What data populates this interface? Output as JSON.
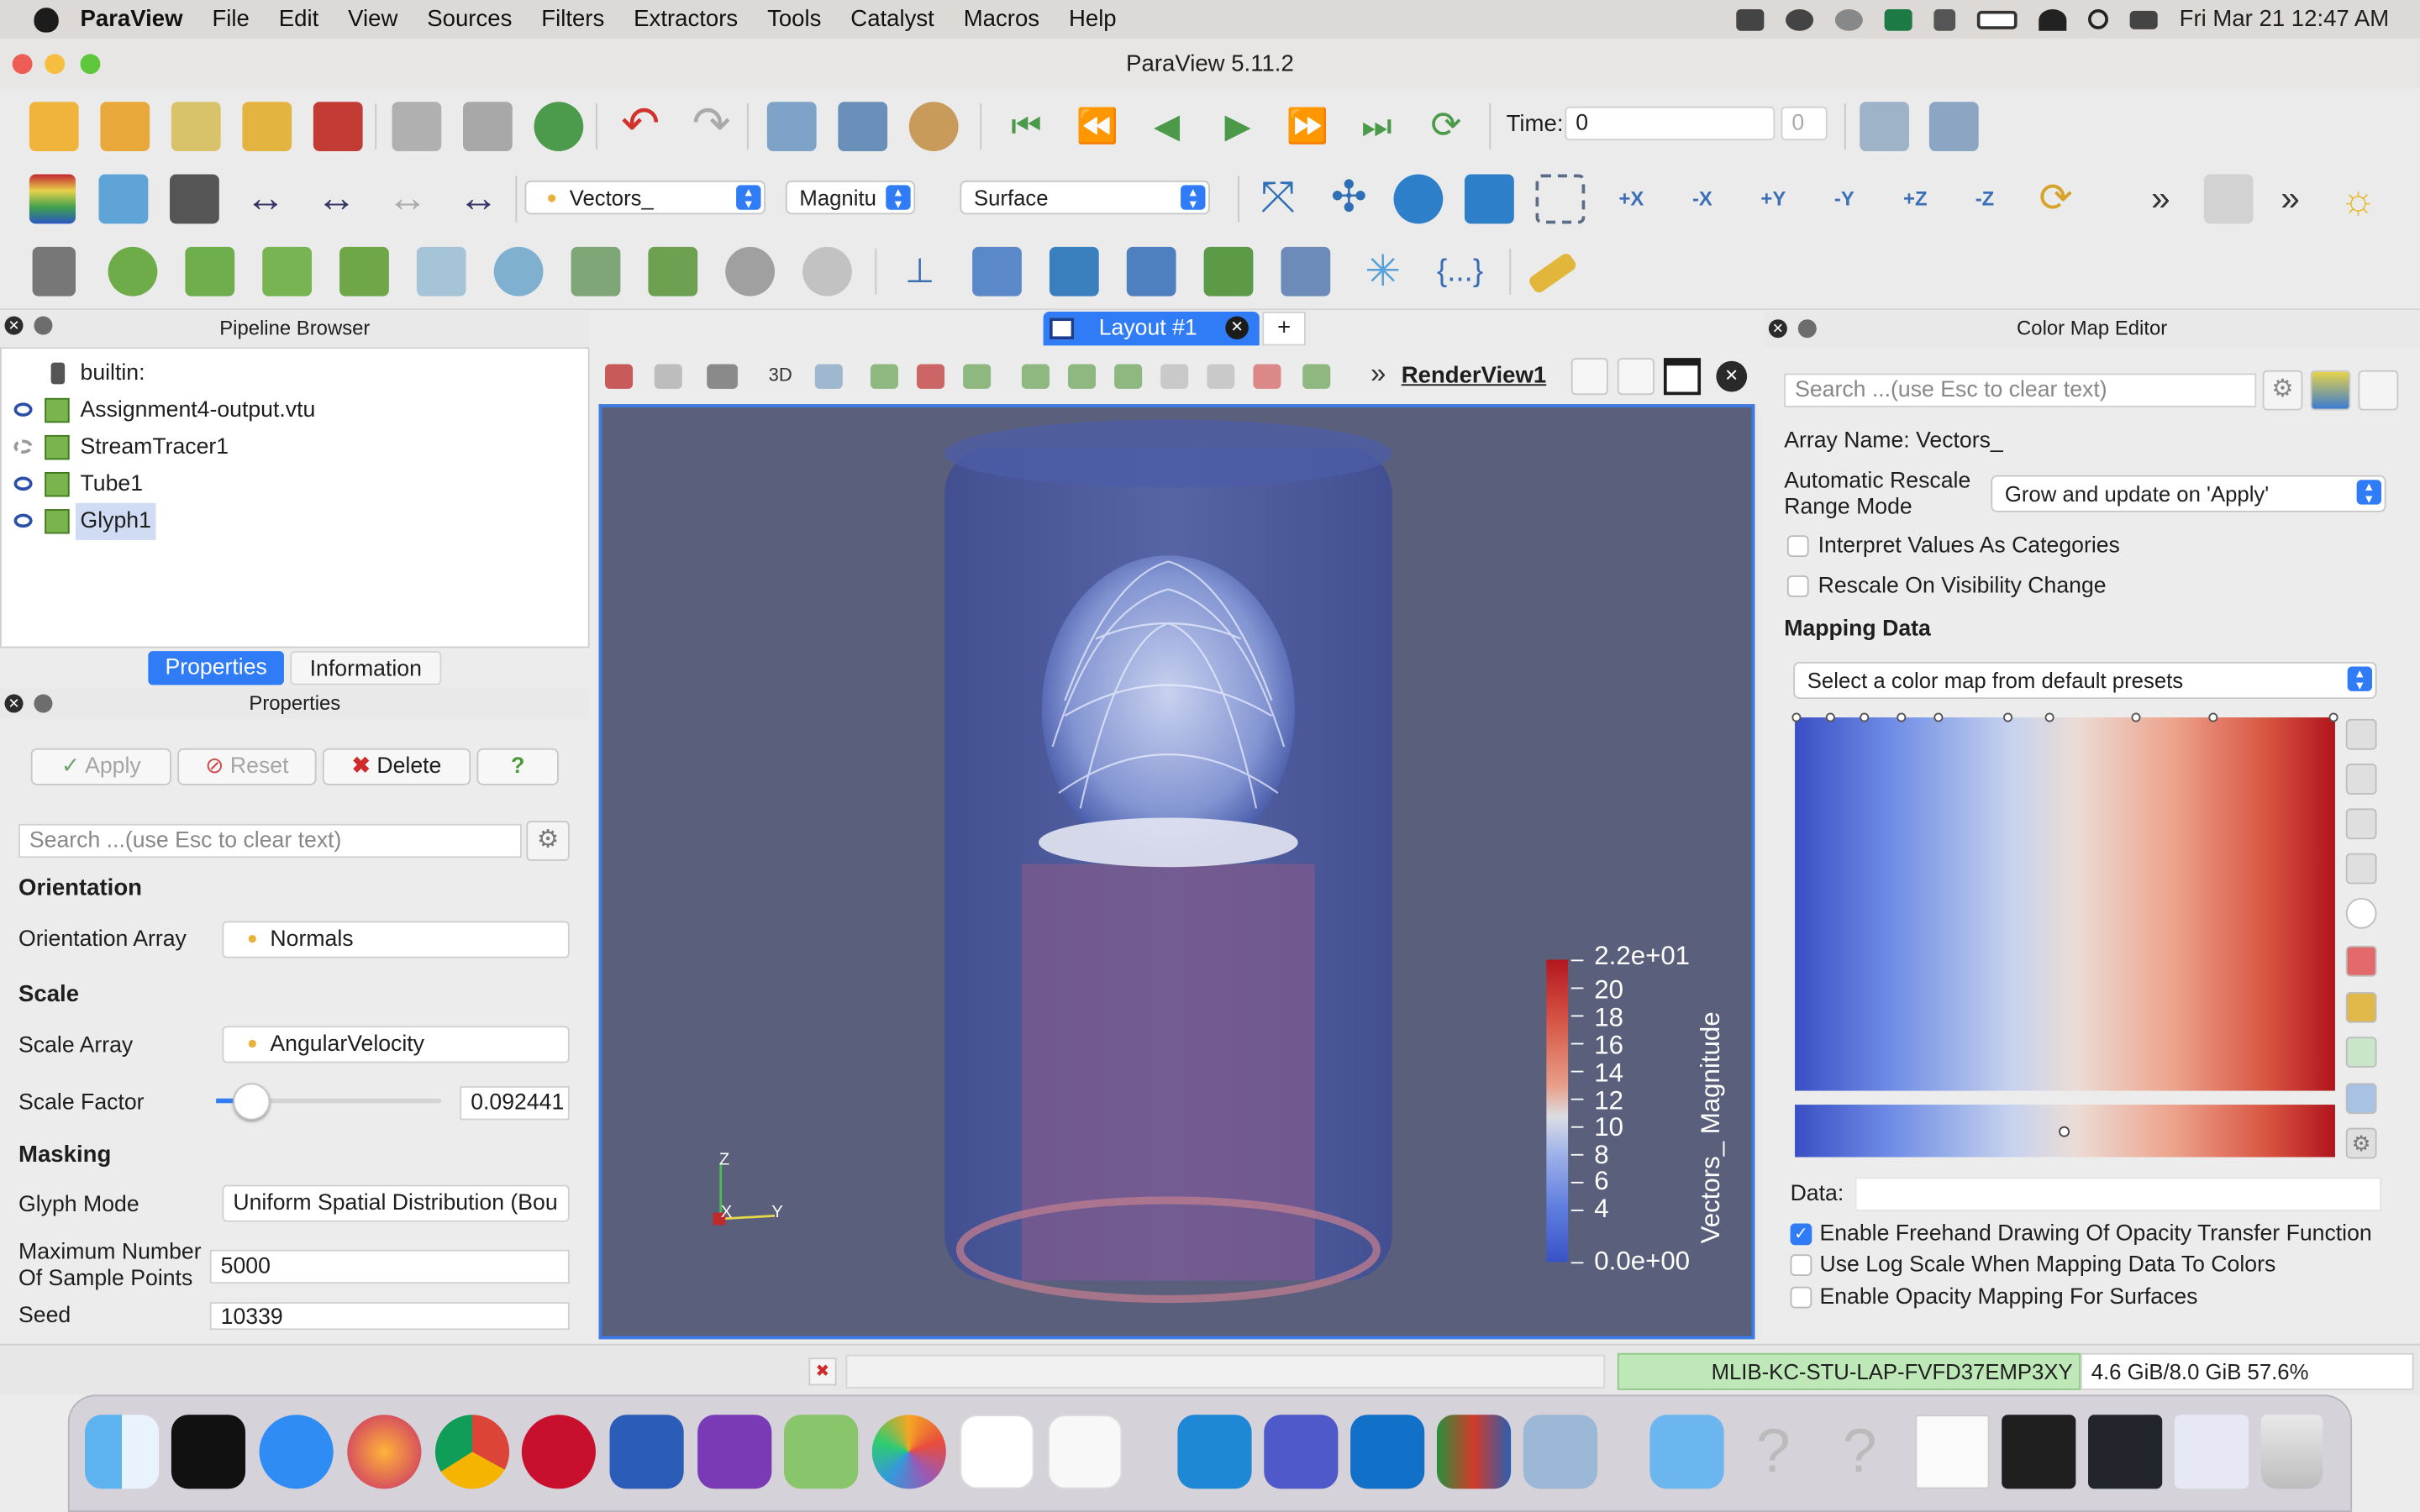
{
  "menubar": {
    "app": "ParaView",
    "items": [
      "File",
      "Edit",
      "View",
      "Sources",
      "Filters",
      "Extractors",
      "Tools",
      "Catalyst",
      "Macros",
      "Help"
    ],
    "clock": "Fri Mar 21  12:47 AM"
  },
  "window": {
    "title": "ParaView 5.11.2"
  },
  "toolbar1": {
    "time_label": "Time:",
    "time_value": "0",
    "time_index": "0"
  },
  "toolbar2": {
    "color_array": "Vectors_",
    "component": "Magnitu",
    "representation": "Surface",
    "view_buttons": [
      "+X",
      "-X",
      "+Y",
      "-Y",
      "+Z",
      "-Z"
    ]
  },
  "pipeline": {
    "title": "Pipeline Browser",
    "root": "builtin:",
    "items": [
      "Assignment4-output.vtu",
      "StreamTracer1",
      "Tube1",
      "Glyph1"
    ]
  },
  "tabs": {
    "properties": "Properties",
    "information": "Information"
  },
  "properties": {
    "title": "Properties",
    "apply": "Apply",
    "reset": "Reset",
    "delete": "Delete",
    "help": "?",
    "search_placeholder": "Search ...(use Esc to clear text)",
    "orientation_section": "Orientation",
    "orientation_array_label": "Orientation Array",
    "orientation_array": "Normals",
    "scale_section": "Scale",
    "scale_array_label": "Scale Array",
    "scale_array": "AngularVelocity",
    "scale_factor_label": "Scale Factor",
    "scale_factor": "0.092441",
    "masking_section": "Masking",
    "glyph_mode_label": "Glyph Mode",
    "glyph_mode": "Uniform Spatial Distribution (Bou",
    "max_points_label_1": "Maximum Number",
    "max_points_label_2": "Of Sample Points",
    "max_points": "5000",
    "seed_label": "Seed",
    "seed": "10339"
  },
  "layout": {
    "tab": "Layout #1",
    "add": "+",
    "threed": "3D",
    "render_view": "RenderView1"
  },
  "colorbar": {
    "title": "Vectors_ Magnitude",
    "labels": [
      "2.2e+01",
      "20",
      "18",
      "16",
      "14",
      "12",
      "10",
      "8",
      "6",
      "4",
      "0.0e+00"
    ]
  },
  "axes": {
    "z": "Z",
    "x": "X",
    "y": "Y"
  },
  "colormap": {
    "title": "Color Map Editor",
    "search_placeholder": "Search ...(use Esc to clear text)",
    "array_name": "Array Name: Vectors_",
    "rescale_label_1": "Automatic Rescale",
    "rescale_label_2": "Range Mode",
    "rescale_mode": "Grow and update on 'Apply'",
    "interpret_categories": "Interpret Values As Categories",
    "rescale_visibility": "Rescale On Visibility Change",
    "mapping_data": "Mapping Data",
    "preset_placeholder": "Select a color map from default presets",
    "data_label": "Data:",
    "freehand": "Enable Freehand Drawing Of Opacity Transfer Function",
    "log_scale": "Use Log Scale When Mapping Data To Colors",
    "opacity_surfaces": "Enable Opacity Mapping For Surfaces"
  },
  "status": {
    "host": "MLIB-KC-STU-LAP-FVFD37EMP3XY",
    "memory": "4.6 GiB/8.0 GiB 57.6%"
  },
  "dock": {
    "apps": [
      "finder-icon",
      "apple-tv-icon",
      "safari-icon",
      "firefox-icon",
      "chrome-icon",
      "utah-icon",
      "word-icon",
      "onenote-icon",
      "maps-icon",
      "photos-icon",
      "news-icon",
      "freeform-icon",
      "vscode-icon",
      "teams-icon",
      "outlook-icon",
      "paraview-icon",
      "preview-icon",
      "applications-icon",
      "help-icon",
      "help-icon",
      "document-icon",
      "terminal-icon",
      "vscode-window-icon",
      "teams-window-icon",
      "trash-icon"
    ]
  }
}
